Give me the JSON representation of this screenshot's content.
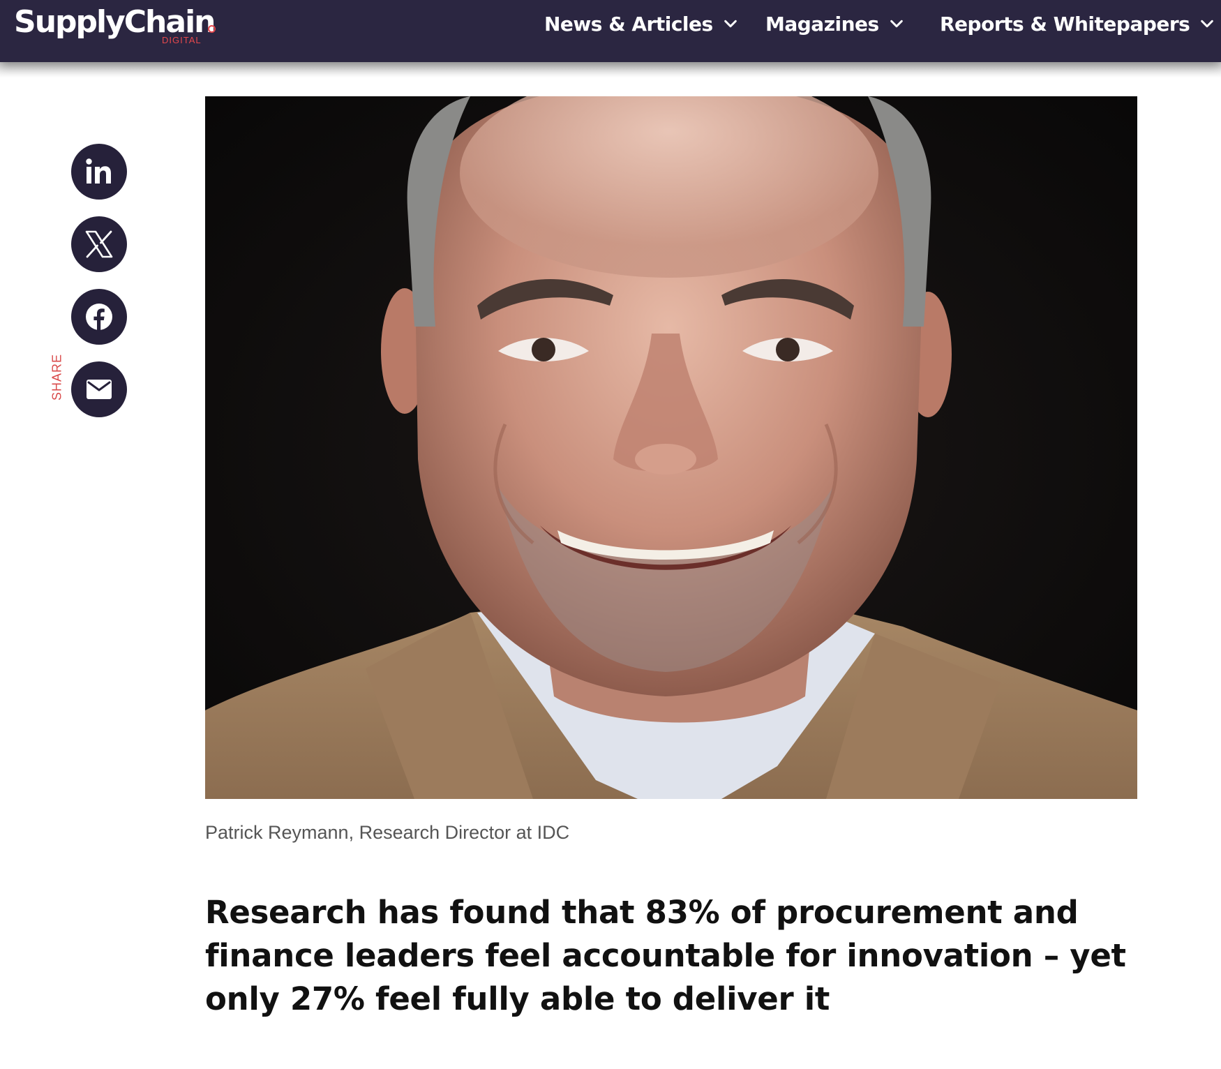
{
  "header": {
    "logo": {
      "main": "SupplyChain",
      "sub": "DIGITAL"
    },
    "nav": [
      {
        "label": "News & Articles"
      },
      {
        "label": "Magazines"
      },
      {
        "label": "Reports & Whitepapers"
      }
    ]
  },
  "share": {
    "label": "SHARE",
    "buttons": [
      {
        "icon": "linkedin-icon"
      },
      {
        "icon": "x-icon"
      },
      {
        "icon": "facebook-icon"
      },
      {
        "icon": "mail-icon"
      }
    ]
  },
  "article": {
    "caption": "Patrick Reymann, Research Director at IDC",
    "headline": "Research has found that 83% of procurement and finance leaders feel accountable for innovation – yet only 27% feel fully able to deliver it"
  },
  "colors": {
    "header_bg": "#2b2641",
    "accent_red": "#e5484d",
    "share_button_bg": "#26213a"
  }
}
